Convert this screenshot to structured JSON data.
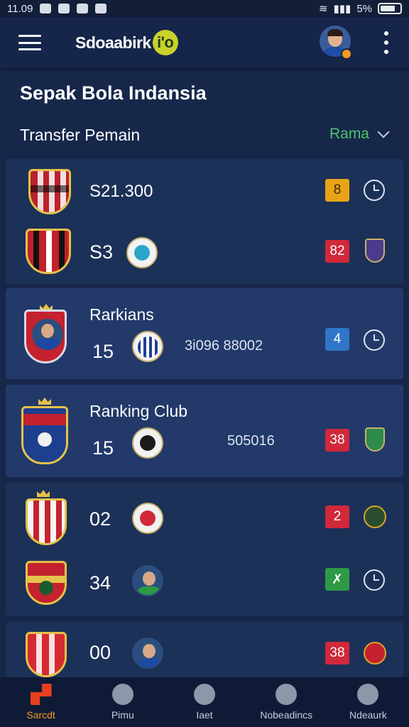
{
  "status_bar": {
    "time": "11.09",
    "battery": "5%"
  },
  "app_bar": {
    "brand": "Sdoaabirk",
    "brand_badge": "i'o"
  },
  "page": {
    "title": "Sepak Bola Indansia"
  },
  "section": {
    "title": "Transfer Pemain",
    "filter_label": "Rama"
  },
  "rows": [
    {
      "number": "S21.300",
      "badge": "8",
      "badge_color": "#e8a416",
      "action_icon": "clock-icon"
    },
    {
      "number": "S3",
      "badge": "82",
      "badge_color": "#d1283a",
      "action_icon": "club-crest-icon"
    },
    {
      "label": "Rarkians",
      "number": "15",
      "mid_value": "3i096 88002",
      "badge": "4",
      "badge_color": "#2f76c9",
      "action_icon": "clock-icon"
    },
    {
      "label": "Ranking Club",
      "number": "15",
      "mid_value": "505016",
      "badge": "38",
      "badge_color": "#d1283a",
      "action_icon": "club-crest-icon"
    },
    {
      "number": "02",
      "badge": "2",
      "badge_color": "#d1283a",
      "action_icon": "ball-icon"
    },
    {
      "number": "34",
      "badge": "✗",
      "badge_color": "#2e9a45",
      "action_icon": "clock-icon"
    },
    {
      "number": "00",
      "badge": "38",
      "badge_color": "#d1283a",
      "action_icon": "ball-icon"
    }
  ],
  "bottom_nav": [
    {
      "label": "Sarcdt",
      "icon": "home-icon",
      "active": true
    },
    {
      "label": "Pimu",
      "icon": "shield-icon",
      "active": false
    },
    {
      "label": "Iaet",
      "icon": "star-icon",
      "active": false
    },
    {
      "label": "Nobeadincs",
      "icon": "check-icon",
      "active": false
    },
    {
      "label": "Ndeaurk",
      "icon": "trophy-icon",
      "active": false
    }
  ],
  "colors": {
    "background": "#16274a",
    "card": "#1c3158",
    "accent_green": "#4fc36b",
    "accent_orange": "#f29a21"
  }
}
